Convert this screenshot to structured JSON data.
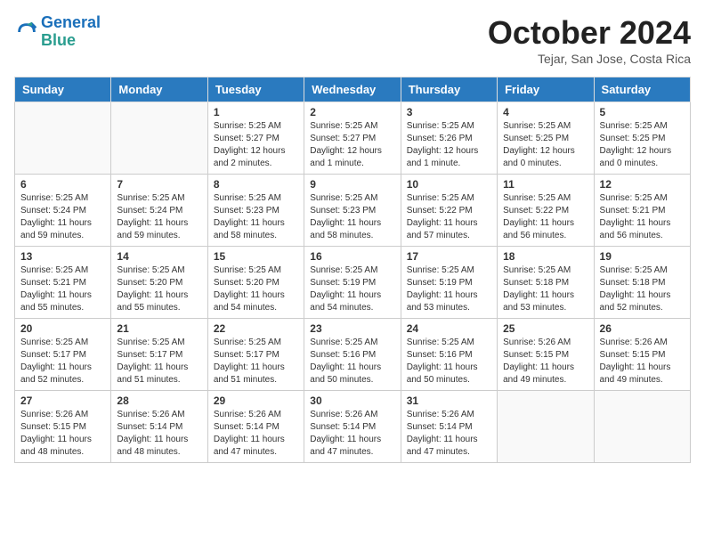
{
  "header": {
    "logo_line1": "General",
    "logo_line2": "Blue",
    "month": "October 2024",
    "location": "Tejar, San Jose, Costa Rica"
  },
  "days_of_week": [
    "Sunday",
    "Monday",
    "Tuesday",
    "Wednesday",
    "Thursday",
    "Friday",
    "Saturday"
  ],
  "weeks": [
    [
      {
        "day": "",
        "info": ""
      },
      {
        "day": "",
        "info": ""
      },
      {
        "day": "1",
        "info": "Sunrise: 5:25 AM\nSunset: 5:27 PM\nDaylight: 12 hours\nand 2 minutes."
      },
      {
        "day": "2",
        "info": "Sunrise: 5:25 AM\nSunset: 5:27 PM\nDaylight: 12 hours\nand 1 minute."
      },
      {
        "day": "3",
        "info": "Sunrise: 5:25 AM\nSunset: 5:26 PM\nDaylight: 12 hours\nand 1 minute."
      },
      {
        "day": "4",
        "info": "Sunrise: 5:25 AM\nSunset: 5:25 PM\nDaylight: 12 hours\nand 0 minutes."
      },
      {
        "day": "5",
        "info": "Sunrise: 5:25 AM\nSunset: 5:25 PM\nDaylight: 12 hours\nand 0 minutes."
      }
    ],
    [
      {
        "day": "6",
        "info": "Sunrise: 5:25 AM\nSunset: 5:24 PM\nDaylight: 11 hours\nand 59 minutes."
      },
      {
        "day": "7",
        "info": "Sunrise: 5:25 AM\nSunset: 5:24 PM\nDaylight: 11 hours\nand 59 minutes."
      },
      {
        "day": "8",
        "info": "Sunrise: 5:25 AM\nSunset: 5:23 PM\nDaylight: 11 hours\nand 58 minutes."
      },
      {
        "day": "9",
        "info": "Sunrise: 5:25 AM\nSunset: 5:23 PM\nDaylight: 11 hours\nand 58 minutes."
      },
      {
        "day": "10",
        "info": "Sunrise: 5:25 AM\nSunset: 5:22 PM\nDaylight: 11 hours\nand 57 minutes."
      },
      {
        "day": "11",
        "info": "Sunrise: 5:25 AM\nSunset: 5:22 PM\nDaylight: 11 hours\nand 56 minutes."
      },
      {
        "day": "12",
        "info": "Sunrise: 5:25 AM\nSunset: 5:21 PM\nDaylight: 11 hours\nand 56 minutes."
      }
    ],
    [
      {
        "day": "13",
        "info": "Sunrise: 5:25 AM\nSunset: 5:21 PM\nDaylight: 11 hours\nand 55 minutes."
      },
      {
        "day": "14",
        "info": "Sunrise: 5:25 AM\nSunset: 5:20 PM\nDaylight: 11 hours\nand 55 minutes."
      },
      {
        "day": "15",
        "info": "Sunrise: 5:25 AM\nSunset: 5:20 PM\nDaylight: 11 hours\nand 54 minutes."
      },
      {
        "day": "16",
        "info": "Sunrise: 5:25 AM\nSunset: 5:19 PM\nDaylight: 11 hours\nand 54 minutes."
      },
      {
        "day": "17",
        "info": "Sunrise: 5:25 AM\nSunset: 5:19 PM\nDaylight: 11 hours\nand 53 minutes."
      },
      {
        "day": "18",
        "info": "Sunrise: 5:25 AM\nSunset: 5:18 PM\nDaylight: 11 hours\nand 53 minutes."
      },
      {
        "day": "19",
        "info": "Sunrise: 5:25 AM\nSunset: 5:18 PM\nDaylight: 11 hours\nand 52 minutes."
      }
    ],
    [
      {
        "day": "20",
        "info": "Sunrise: 5:25 AM\nSunset: 5:17 PM\nDaylight: 11 hours\nand 52 minutes."
      },
      {
        "day": "21",
        "info": "Sunrise: 5:25 AM\nSunset: 5:17 PM\nDaylight: 11 hours\nand 51 minutes."
      },
      {
        "day": "22",
        "info": "Sunrise: 5:25 AM\nSunset: 5:17 PM\nDaylight: 11 hours\nand 51 minutes."
      },
      {
        "day": "23",
        "info": "Sunrise: 5:25 AM\nSunset: 5:16 PM\nDaylight: 11 hours\nand 50 minutes."
      },
      {
        "day": "24",
        "info": "Sunrise: 5:25 AM\nSunset: 5:16 PM\nDaylight: 11 hours\nand 50 minutes."
      },
      {
        "day": "25",
        "info": "Sunrise: 5:26 AM\nSunset: 5:15 PM\nDaylight: 11 hours\nand 49 minutes."
      },
      {
        "day": "26",
        "info": "Sunrise: 5:26 AM\nSunset: 5:15 PM\nDaylight: 11 hours\nand 49 minutes."
      }
    ],
    [
      {
        "day": "27",
        "info": "Sunrise: 5:26 AM\nSunset: 5:15 PM\nDaylight: 11 hours\nand 48 minutes."
      },
      {
        "day": "28",
        "info": "Sunrise: 5:26 AM\nSunset: 5:14 PM\nDaylight: 11 hours\nand 48 minutes."
      },
      {
        "day": "29",
        "info": "Sunrise: 5:26 AM\nSunset: 5:14 PM\nDaylight: 11 hours\nand 47 minutes."
      },
      {
        "day": "30",
        "info": "Sunrise: 5:26 AM\nSunset: 5:14 PM\nDaylight: 11 hours\nand 47 minutes."
      },
      {
        "day": "31",
        "info": "Sunrise: 5:26 AM\nSunset: 5:14 PM\nDaylight: 11 hours\nand 47 minutes."
      },
      {
        "day": "",
        "info": ""
      },
      {
        "day": "",
        "info": ""
      }
    ]
  ]
}
